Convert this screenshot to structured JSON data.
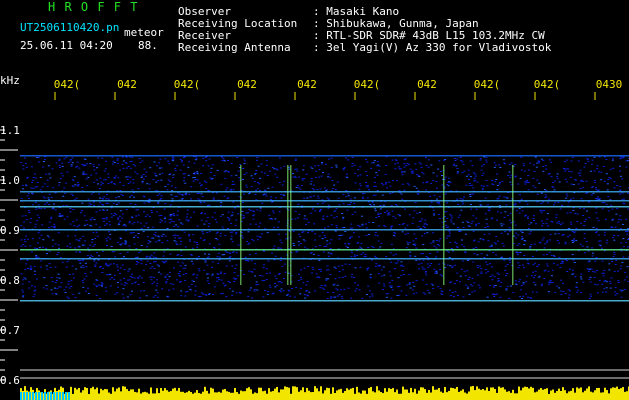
{
  "header": {
    "title": "H R O F F T",
    "filename": "UT2506110420.pn",
    "mode": "meteor",
    "datetime": "25.06.11 04:20",
    "count": "88.",
    "info": [
      {
        "label": "Observer",
        "value": ": Masaki Kano"
      },
      {
        "label": "Receiving Location",
        "value": ": Shibukawa, Gunma, Japan"
      },
      {
        "label": "Receiver",
        "value": ": RTL-SDR SDR# 43dB L15 103.2MHz CW"
      },
      {
        "label": "Receiving Antenna",
        "value": ": 3el Yagi(V) Az 330 for Vladivostok"
      }
    ]
  },
  "axis": {
    "y_unit": "kHz",
    "y_labels": [
      "1.1",
      "1.0",
      "0.9",
      "0.8",
      "0.7",
      "0.6"
    ],
    "x_labels": [
      "042(",
      "042",
      "042(",
      "042",
      "042",
      "042(",
      "042",
      "042(",
      "042(",
      "0430"
    ]
  },
  "colors": {
    "background": "#000000",
    "signal_low": "#0b1fd6",
    "signal_high": "#8cff7a",
    "axis_text": "#f2e600",
    "title": "#22e022",
    "filename": "#00e5ff"
  }
}
